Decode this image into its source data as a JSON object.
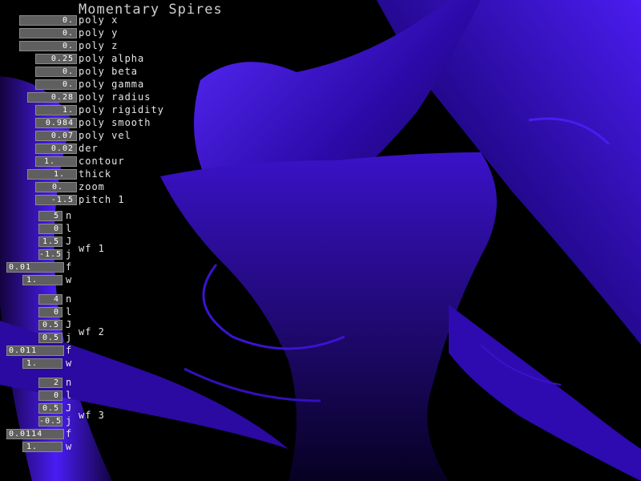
{
  "app": {
    "title": "Momentary Spires"
  },
  "params": [
    {
      "label": "poly x",
      "value": "0."
    },
    {
      "label": "poly y",
      "value": "0."
    },
    {
      "label": "poly z",
      "value": "0."
    },
    {
      "label": "poly alpha",
      "value": "0.25"
    },
    {
      "label": "poly beta",
      "value": "0."
    },
    {
      "label": "poly gamma",
      "value": "0."
    },
    {
      "label": "poly radius",
      "value": "0.28"
    },
    {
      "label": "poly rigidity",
      "value": "1."
    },
    {
      "label": "poly smooth",
      "value": "0.984"
    },
    {
      "label": "poly vel",
      "value": "0.07"
    },
    {
      "label": "der",
      "value": "0.02"
    },
    {
      "label": "contour",
      "value": "1."
    },
    {
      "label": "thick",
      "value": "1."
    },
    {
      "label": "zoom",
      "value": "0."
    },
    {
      "label": "pitch 1",
      "value": "-1.5"
    }
  ],
  "wavefronts": [
    {
      "title": "wf 1",
      "fields": [
        {
          "key": "n",
          "value": "5"
        },
        {
          "key": "l",
          "value": "0"
        },
        {
          "key": "J",
          "value": "1.5"
        },
        {
          "key": "j",
          "value": "-1.5"
        },
        {
          "key": "f",
          "value": "0.01"
        },
        {
          "key": "w",
          "value": "1."
        }
      ]
    },
    {
      "title": "wf 2",
      "fields": [
        {
          "key": "n",
          "value": "4"
        },
        {
          "key": "l",
          "value": "0"
        },
        {
          "key": "J",
          "value": "0.5"
        },
        {
          "key": "j",
          "value": "0.5"
        },
        {
          "key": "f",
          "value": "0.011"
        },
        {
          "key": "w",
          "value": "1."
        }
      ]
    },
    {
      "title": "wf 3",
      "fields": [
        {
          "key": "n",
          "value": "2"
        },
        {
          "key": "l",
          "value": "0"
        },
        {
          "key": "J",
          "value": "0.5"
        },
        {
          "key": "j",
          "value": "-0.5"
        },
        {
          "key": "f",
          "value": "0.0114"
        },
        {
          "key": "w",
          "value": "1."
        }
      ]
    }
  ],
  "colors": {
    "background": "#000000",
    "spire_color": "#3a10d8",
    "field_bg": "#5f5f5f"
  }
}
